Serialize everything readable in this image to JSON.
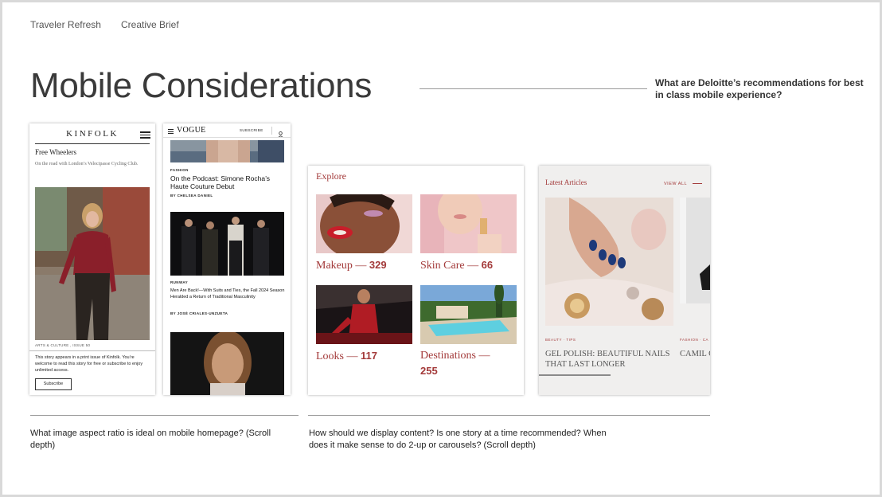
{
  "header": {
    "crumb1": "Traveler Refresh",
    "crumb2": "Creative Brief"
  },
  "title": "Mobile Considerations",
  "question_top": "What are Deloitte’s recommendations for best in class mobile experience?",
  "kinfolk": {
    "logo": "KINFOLK",
    "headline": "Free Wheelers",
    "subhead": "On the road with London’s Velocipasse Cycling Club.",
    "tag": "ARTS & CULTURE , ISSUE 50",
    "note": "This story appears in a print issue of Kinfolk. You’re welcome to read this story for free or subscribe to enjoy unlimited access.",
    "button": "Subscribe"
  },
  "vogue": {
    "logo": "VOGUE",
    "subscribe": "SUBSCRIBE",
    "cat1": "FASHION",
    "headline1": "On the Podcast: Simone Rocha’s Haute Couture Debut",
    "byline1": "BY CHELSEA DANIEL",
    "cat2": "RUNWAY",
    "headline2": "Men Are Back!—With Suits and Ties, the Fall 2024 Season Heralded a Return of Traditional Masculinity",
    "byline2": "BY JOSÉ CRIALES-UNZUETA"
  },
  "explore": {
    "title": "Explore",
    "tiles": [
      {
        "name": "Makeup —",
        "count": "329"
      },
      {
        "name": "Skin Care —",
        "count": "66"
      },
      {
        "name": "Looks —",
        "count": "117"
      },
      {
        "name": "Destinations —",
        "count": "255"
      }
    ]
  },
  "latest": {
    "title": "Latest Articles",
    "view_all": "VIEW ALL",
    "tag": "BEAUTY · TIPS",
    "headline": "GEL POLISH: BEAUTIFUL NAILS THAT LAST LONGER",
    "tag2": "FASHION · CA",
    "headline2": "CAMIL COLLE"
  },
  "questions": {
    "left": "What image aspect ratio is ideal on mobile homepage? (Scroll depth)",
    "right": "How should we display content? Is one story at a time recommended? When does it make sense to do 2-up or carousels? (Scroll depth)"
  },
  "colors": {
    "accent": "#a33a3a",
    "text": "#3a3a3a"
  }
}
